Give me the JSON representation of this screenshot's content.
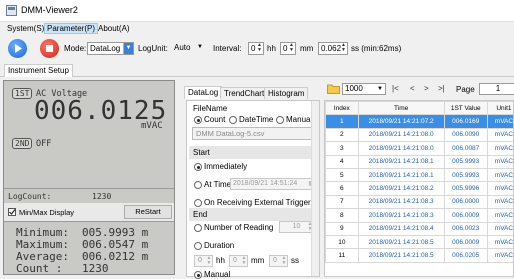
{
  "window": {
    "title": "DMM-Viewer2"
  },
  "menu": [
    {
      "label": "System(S)"
    },
    {
      "label": "Parameter(P)"
    },
    {
      "label": "About(A)"
    }
  ],
  "toolbar": {
    "mode_label": "Mode:",
    "mode_value": "DataLog",
    "logunit_label": "LogUnit:",
    "logunit_value": "Auto",
    "interval_label": "Interval:",
    "hh_value": "0",
    "hh_label": "hh",
    "mm_value": "0",
    "mm_label": "mm",
    "ss_value": "0.062",
    "ss_label": "ss (min:62ms)"
  },
  "instrument_tab": "Instrument Setup",
  "display": {
    "primary_tag": "1ST",
    "primary_label": "AC Voltage",
    "primary_value": "006.0125",
    "primary_unit": "mVAC",
    "secondary_tag": "2ND",
    "secondary_label": "OFF",
    "logcount_label": "LogCount:",
    "logcount_value": "1230",
    "minmax_label": "Min/Max Display",
    "restart_label": "ReStart",
    "stats": [
      {
        "label": "Minimum:",
        "value": "005.9993 m"
      },
      {
        "label": "Maximum:",
        "value": "006.0547 m"
      },
      {
        "label": "Average:",
        "value": "006.0212 m"
      },
      {
        "label": "Count  :",
        "value": "1230"
      }
    ]
  },
  "tabs": [
    {
      "label": "DataLog"
    },
    {
      "label": "TrendChart"
    },
    {
      "label": "Histogram"
    }
  ],
  "filename": {
    "header": "FileName",
    "opt_count": "Count",
    "opt_datetime": "DateTime",
    "opt_manual": "Manual",
    "value": "DMM DataLog-5.csv"
  },
  "start": {
    "header": "Start",
    "opt_immediately": "Immediately",
    "opt_attime": "At Time",
    "attime_value": "2018/09/21 14:51:24",
    "opt_trigger": "On Receiving External Trigger"
  },
  "end": {
    "header": "End",
    "opt_number": "Number of Reading",
    "number_value": "10",
    "opt_duration": "Duration",
    "dur_hh": "0",
    "hh": "hh",
    "dur_mm": "0",
    "mm": "mm",
    "dur_ss": "0",
    "ss": "ss",
    "opt_manual": "Manual"
  },
  "pager": {
    "per_page": "1000",
    "page_label": "Page",
    "page_value": "1"
  },
  "table": {
    "columns": [
      "Index",
      "Time",
      "1ST Value",
      "Unit1"
    ],
    "rows": [
      [
        "1",
        "2018/09/21 14:21:07.2",
        "006.0169",
        "mVAC"
      ],
      [
        "2",
        "2018/09/21 14:21:08.0",
        "006.0090",
        "mVAC"
      ],
      [
        "3",
        "2018/09/21 14:21:08.0",
        "006.0087",
        "mVAC"
      ],
      [
        "4",
        "2018/09/21 14:21:08.1",
        "005.9993",
        "mVAC"
      ],
      [
        "5",
        "2018/09/21 14:21:08.1",
        "005.9993",
        "mVAC"
      ],
      [
        "6",
        "2018/09/21 14:21:08.2",
        "005.9996",
        "mVAC"
      ],
      [
        "7",
        "2018/09/21 14:21:08.3",
        "006.0000",
        "mVAC"
      ],
      [
        "8",
        "2018/09/21 14:21:08.3",
        "006.0009",
        "mVAC"
      ],
      [
        "9",
        "2018/09/21 14:21:08.4",
        "006.0023",
        "mVAC"
      ],
      [
        "10",
        "2018/09/21 14:21:08.5",
        "006.0009",
        "mVAC"
      ],
      [
        "11",
        "2018/09/21 14:21:08.5",
        "006.0205",
        "mVAC"
      ]
    ]
  }
}
